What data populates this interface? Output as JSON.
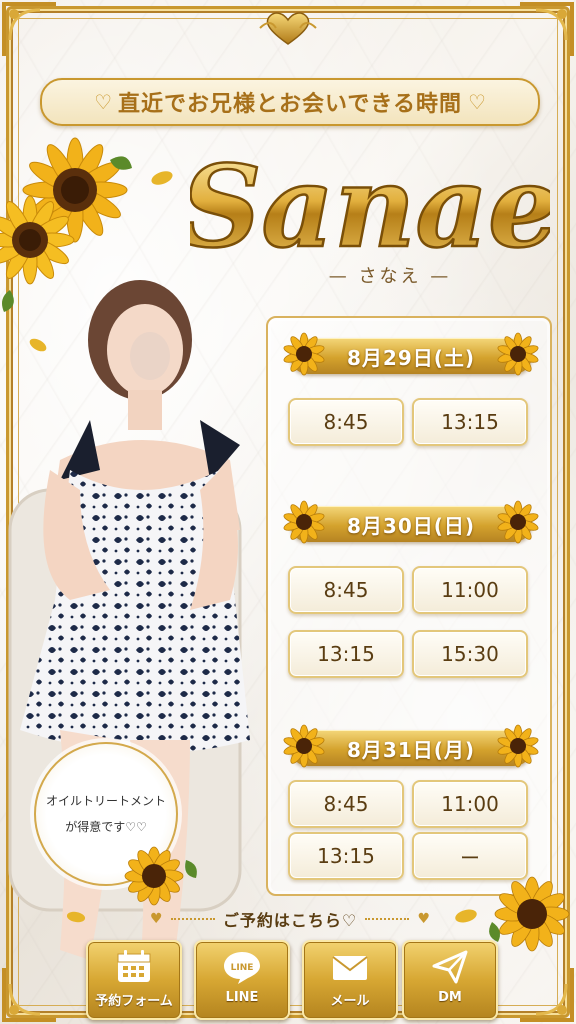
{
  "headline": "直近でお兄様とお会いできる時間",
  "name": "Sanae",
  "name_kana": "さなえ",
  "colors": {
    "gold": "#c9982f",
    "gold_dark": "#a7701a",
    "text_brown": "#5a3d12"
  },
  "schedule": [
    {
      "date": "8月29日(土)",
      "slots": [
        "8:45",
        "13:15"
      ]
    },
    {
      "date": "8月30日(日)",
      "slots": [
        "8:45",
        "11:00",
        "13:15",
        "15:30"
      ]
    },
    {
      "date": "8月31日(月)",
      "slots": [
        "8:45",
        "11:00",
        "13:15",
        "ー"
      ]
    }
  ],
  "bubble": {
    "line1": "オイルトリートメント",
    "line2": "が得意です♡♡"
  },
  "reserve_label": "ご予約はこちら♡",
  "buttons": [
    {
      "label": "予約フォーム",
      "icon": "calendar-icon"
    },
    {
      "label": "LINE",
      "icon": "line-icon",
      "icon_text": "LINE"
    },
    {
      "label": "メール",
      "icon": "mail-icon"
    },
    {
      "label": "DM",
      "icon": "send-icon"
    }
  ]
}
